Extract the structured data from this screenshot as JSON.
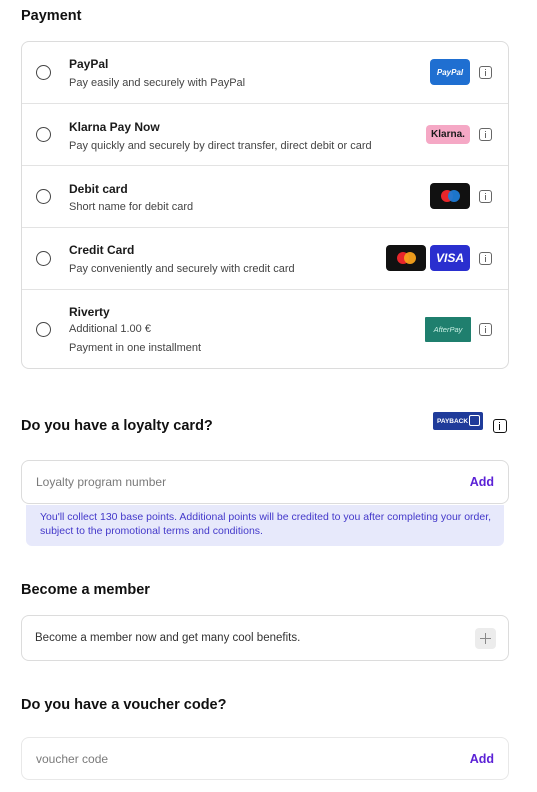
{
  "payment": {
    "title": "Payment",
    "methods": [
      {
        "name": "PayPal",
        "desc": "Pay easily and securely with PayPal",
        "logo": "PayPal"
      },
      {
        "name": "Klarna Pay Now",
        "desc": "Pay quickly and securely by direct transfer, direct debit or card",
        "logo": "Klarna."
      },
      {
        "name": "Debit card",
        "desc": "Short name for debit card",
        "logo": "maestro-logo"
      },
      {
        "name": "Credit Card",
        "desc": "Pay conveniently and securely with credit card",
        "logo": "VISA"
      },
      {
        "name": "Riverty",
        "desc": "Additional 1.00 €",
        "desc2": "Payment in one installment",
        "logo": "AfterPay"
      }
    ]
  },
  "loyalty": {
    "title": "Do you have a loyalty card?",
    "logo": "PAYBACK",
    "placeholder": "Loyalty program number",
    "add_label": "Add",
    "notice": "You'll collect 130 base points. Additional points will be credited to you after completing your order, subject to the promotional terms and conditions."
  },
  "member": {
    "title": "Become a member",
    "text": "Become a member now and get many cool benefits."
  },
  "voucher": {
    "title": "Do you have a voucher code?",
    "placeholder": "voucher code",
    "add_label": "Add"
  },
  "colors": {
    "accent": "#5b21d6",
    "notice_bg": "#e7e9fb",
    "notice_text": "#4338ca"
  }
}
